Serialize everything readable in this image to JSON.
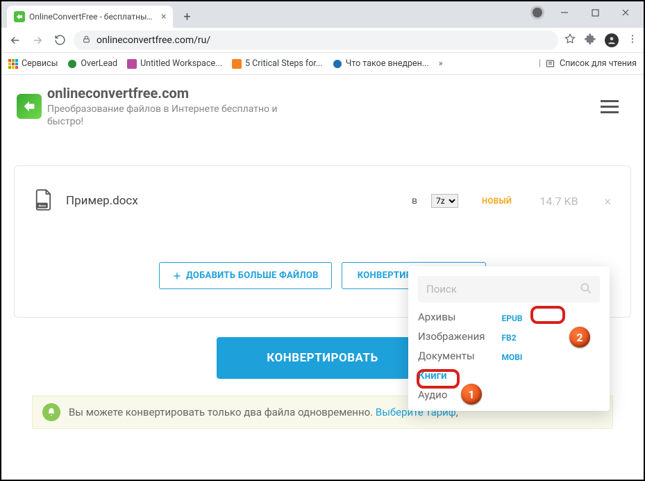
{
  "browser": {
    "tab_title": "OnlineConvertFree - бесплатный...",
    "url": "onlineconvertfree.com/ru/",
    "bookmarks": {
      "apps": "Сервисы",
      "overlead": "OverLead",
      "workspace": "Untitled Workspace...",
      "steps": "5 Critical Steps for...",
      "vnedren": "Что такое внедрен...",
      "more": "»",
      "reading_list": "Список для чтения"
    }
  },
  "site": {
    "title": "onlineconvertfree.com",
    "subtitle": "Преобразование файлов в Интернете бесплатно и быстро!"
  },
  "file": {
    "name": "Пример.docx",
    "to": "в",
    "format": "7z",
    "status": "НОВЫЙ",
    "size": "14.7 KB"
  },
  "buttons": {
    "add_more": "ДОБАВИТЬ БОЛЬШЕ ФАЙЛОВ",
    "convert_all": "КОНВЕРТИРОВАТЬ ВСЕ В",
    "convert_big": "КОНВЕРТИРОВАТЬ"
  },
  "dropdown": {
    "search_placeholder": "Поиск",
    "cats": {
      "archives": "Архивы",
      "images": "Изображения",
      "documents": "Документы",
      "books": "Книги",
      "audio": "Аудио"
    },
    "fmts": {
      "epub": "EPUB",
      "fb2": "FB2",
      "mobi": "MOBI"
    }
  },
  "notice": {
    "text": "Вы можете конвертировать только два файла одновременно. ",
    "link": "Выберите тариф"
  }
}
